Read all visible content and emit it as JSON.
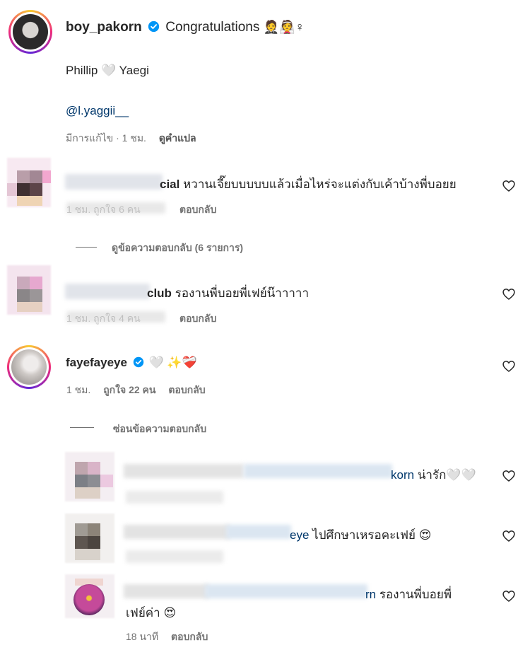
{
  "post": {
    "username": "boy_pakorn",
    "caption": "Congratulations",
    "caption_emoji": "🤵👰♀",
    "line2": "Phillip 🤍 Yaegi",
    "mention": "@l.yaggii__",
    "edited": "มีการแก้ไข · 1 ชม.",
    "translate": "ดูคำแปล"
  },
  "comments": [
    {
      "username_visible": "cial",
      "text": "หวานเจี๊ยบบบบบแล้วเมื่อไหร่จะแต่งกับเค้าบ้างพี่บอยย",
      "meta": "1 ชม.   ถูกใจ 6 คน",
      "reply": "ตอบกลับ",
      "view_replies": "ดูข้อความตอบกลับ (6 รายการ)"
    },
    {
      "username_visible": "club",
      "text": "รองานพี่บอยพี่เฟย์น๊าาาาา",
      "meta": "1 ชม.   ถูกใจ 4 คน",
      "reply": "ตอบกลับ"
    },
    {
      "username": "fayefayeye",
      "text": "🤍",
      "emoji": "✨❤️‍🩹",
      "time": "1 ชม.",
      "likes": "ถูกใจ 22 คน",
      "reply": "ตอบกลับ",
      "hide_replies": "ซ่อนข้อความตอบกลับ"
    }
  ],
  "replies": [
    {
      "mention_visible": "korn",
      "text": "น่ารัก🤍🤍"
    },
    {
      "mention_visible": "eye",
      "text": "ไปศึกษาเหรอคะเฟย์",
      "emoji": "😍"
    },
    {
      "mention_visible": "rn",
      "text": "รองานพี่บอยพี่",
      "text2": "เฟย์ค่า",
      "emoji": "😍",
      "time": "18 นาที",
      "reply": "ตอบกลับ"
    }
  ],
  "colors": {
    "link": "#00376b",
    "meta": "#737373",
    "verified": "#0095f6"
  }
}
